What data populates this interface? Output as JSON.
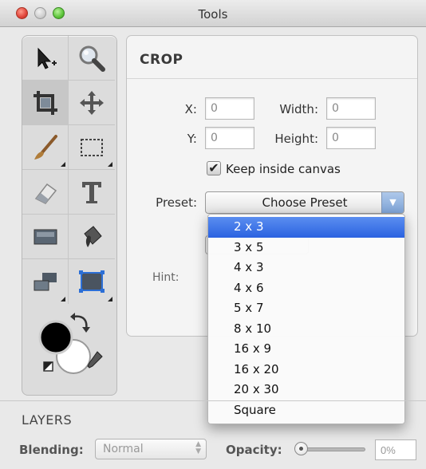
{
  "window": {
    "title": "Tools"
  },
  "tools": [
    {
      "name": "select-tool",
      "icon": "pointer-plus-icon"
    },
    {
      "name": "zoom-tool",
      "icon": "magnifier-icon"
    },
    {
      "name": "crop-tool",
      "icon": "crop-icon",
      "selected": true
    },
    {
      "name": "move-tool",
      "icon": "move-arrows-icon"
    },
    {
      "name": "brush-tool",
      "icon": "brush-icon"
    },
    {
      "name": "marquee-tool",
      "icon": "dashed-rectangle-icon"
    },
    {
      "name": "eraser-tool",
      "icon": "eraser-icon"
    },
    {
      "name": "text-tool",
      "icon": "text-t-icon"
    },
    {
      "name": "shape-tool",
      "icon": "rectangle-icon"
    },
    {
      "name": "fill-tool",
      "icon": "paint-bucket-icon"
    },
    {
      "name": "layer-tool",
      "icon": "stacked-rects-icon"
    },
    {
      "name": "transform-tool",
      "icon": "transform-rect-icon"
    }
  ],
  "crop": {
    "title": "CROP",
    "x_label": "X:",
    "x_value": "0",
    "y_label": "Y:",
    "y_value": "0",
    "width_label": "Width:",
    "width_value": "0",
    "height_label": "Height:",
    "height_value": "0",
    "keep_inside_label": "Keep inside canvas",
    "keep_inside_checked": true,
    "preset_label": "Preset:",
    "preset_button": "Choose Preset",
    "hint_label": "Hint:"
  },
  "preset_menu": {
    "items": [
      "2 x 3",
      "3 x 5",
      "4 x 3",
      "4 x 6",
      "5 x 7",
      "8 x 10",
      "16 x 9",
      "16 x 20",
      "20 x 30",
      "Square"
    ],
    "highlighted_index": 0
  },
  "layers": {
    "title": "LAYERS",
    "blending_label": "Blending:",
    "blending_value": "Normal",
    "opacity_label": "Opacity:",
    "opacity_value": "0%",
    "opacity_fraction": 0
  },
  "colors": {
    "highlight": "#2a62e0",
    "foreground": "#000000",
    "background": "#ffffff"
  }
}
